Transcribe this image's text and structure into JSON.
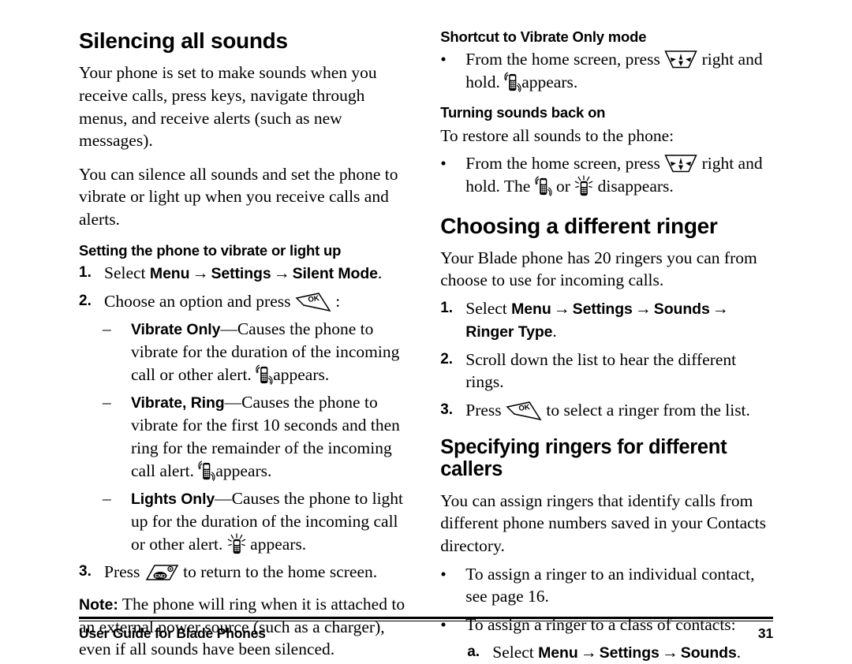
{
  "document": {
    "title": "User Guide for Blade Phones",
    "page_number": "31"
  },
  "icons": {
    "ok_key": "ok-key-icon",
    "end_key": "end-key-icon",
    "nav_key": "navigation-key-icon",
    "vibrate": "vibrate-phone-icon",
    "lights": "lights-only-phone-icon"
  },
  "left_column": {
    "heading": "Silencing all sounds",
    "intro_paragraph_1": "Your phone is set to make sounds when you receive calls, press keys, navigate through menus, and receive alerts (such as new messages).",
    "intro_paragraph_2": "You can silence all sounds and set the phone to vibrate or light up when you receive calls and alerts.",
    "subheading": "Setting the phone to vibrate or light up",
    "step1": {
      "marker": "1.",
      "lead": "Select",
      "menu": "Menu",
      "arrow1": "→",
      "settings": "Settings",
      "arrow2": "→",
      "target": "Silent Mode",
      "period": "."
    },
    "step2": {
      "marker": "2.",
      "text_before": "Choose an option and press",
      "text_after": ":"
    },
    "options": [
      {
        "marker": "–",
        "term": "Vibrate Only",
        "dash": "—",
        "description": "Causes the phone to vibrate for the duration of the incoming call or other alert.",
        "icon_note": "appears.",
        "icon": "vibrate-phone-icon"
      },
      {
        "marker": "–",
        "term": "Vibrate, Ring",
        "dash": "—",
        "description": "Causes the phone to vibrate for the first 10 seconds and then ring for the remainder of the incoming call alert.",
        "icon_note": "appears.",
        "icon": "vibrate-phone-icon"
      },
      {
        "marker": "–",
        "term": "Lights Only",
        "dash": "—",
        "description": "Causes the phone to light up for the duration of the incoming call or other alert.",
        "icon_note": "appears.",
        "icon": "lights-only-phone-icon"
      }
    ],
    "step3": {
      "marker": "3.",
      "text_before": "Press",
      "text_after": "to return to the home screen."
    },
    "note": {
      "label": "Note:",
      "text": "The phone will ring when it is attached to an external power source (such as a charger), even if all sounds have been silenced."
    }
  },
  "right_column": {
    "shortcut": {
      "heading": "Shortcut to Vibrate Only mode",
      "bullet": "•",
      "text_before": "From the home screen, press",
      "text_middle": "right and hold.",
      "text_after": "appears."
    },
    "turning_back_on": {
      "heading": "Turning sounds back on",
      "intro": "To restore all sounds to the phone:",
      "bullet": "•",
      "text_before": "From the home screen, press",
      "text_middle": "right and hold. The",
      "text_or": "or",
      "text_after": "disappears."
    },
    "choosing_ringer": {
      "heading": "Choosing a different ringer",
      "intro": "Your Blade phone has 20 ringers you can from choose to use for incoming calls.",
      "step1": {
        "marker": "1.",
        "lead": "Select",
        "menu": "Menu",
        "arrow1": "→",
        "settings": "Settings",
        "arrow2": "→",
        "sounds": "Sounds",
        "arrow3": "→",
        "target": "Ringer Type",
        "period": "."
      },
      "step2": {
        "marker": "2.",
        "text": "Scroll down the list to hear the different rings."
      },
      "step3": {
        "marker": "3.",
        "text_before": "Press",
        "text_after": "to select a ringer from the list."
      }
    },
    "specifying_ringers": {
      "heading": "Specifying ringers for different callers",
      "intro": "You can assign ringers that identify calls from different phone numbers saved in your Contacts directory.",
      "bullet1": {
        "bullet": "•",
        "text": "To assign a ringer to an individual contact, see page 16."
      },
      "bullet2": {
        "bullet": "•",
        "text": "To assign a ringer to a class of contacts:"
      },
      "sub_a": {
        "marker": "a.",
        "lead": "Select",
        "menu": "Menu",
        "arrow1": "→",
        "settings": "Settings",
        "arrow2": "→",
        "sounds": "Sounds",
        "period": "."
      }
    }
  }
}
